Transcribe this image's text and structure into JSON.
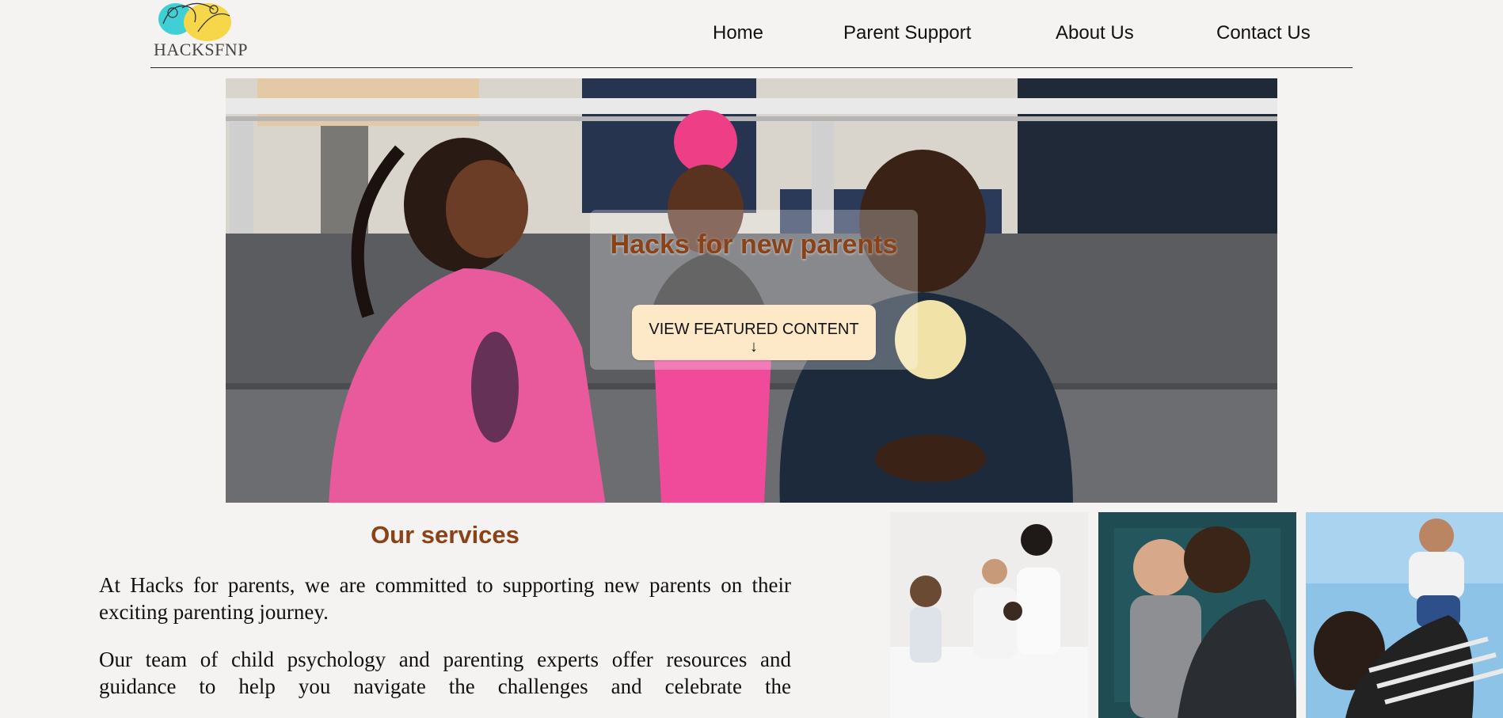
{
  "header": {
    "logo_text": "HACKSFNP",
    "nav": [
      "Home",
      "Parent Support",
      "About Us",
      "Contact Us"
    ]
  },
  "hero": {
    "title": "Hacks for new parents",
    "button_label": "VIEW FEATURED CONTENT",
    "button_icon": "arrow-down-icon",
    "button_arrow": "↓"
  },
  "services": {
    "title": "Our services",
    "paragraphs": [
      "At Hacks for parents, we are committed to supporting new parents on their exciting parenting journey.",
      "Our team of child psychology and parenting experts offer resources and guidance to help you navigate the challenges and celebrate the"
    ]
  },
  "gallery": {
    "photos": [
      "family-on-bed-photo",
      "father-kissing-baby-photo",
      "parent-lifting-baby-photo"
    ]
  },
  "colors": {
    "accent": "#8a4218",
    "background": "#f5f3f1",
    "button_bg": "#fde9c7"
  }
}
